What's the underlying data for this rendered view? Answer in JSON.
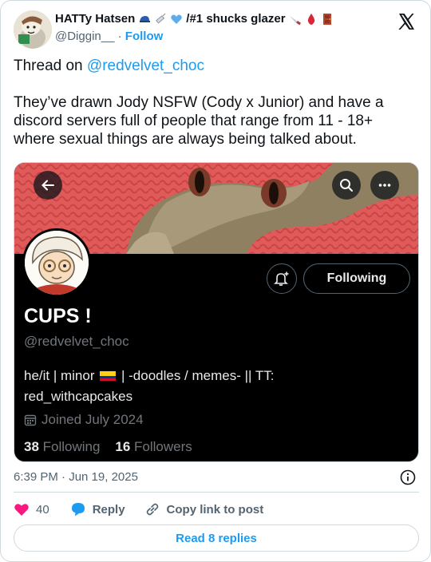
{
  "author": {
    "display_name": "HATTy Hatsen",
    "name_suffix": "/#1 shucks glazer",
    "handle": "@Diggin__",
    "separator": "·",
    "follow_label": "Follow"
  },
  "tweet": {
    "line1_prefix": "Thread on ",
    "line1_mention": "@redvelvet_choc",
    "body": "They’ve drawn Jody NSFW (Cody x Junior) and have a discord servers full of people that range from 11 - 18+ where sexual things are always being talked about."
  },
  "embedded_profile": {
    "name": "CUPS !",
    "handle": "@redvelvet_choc",
    "bio_part1": "he/it | minor",
    "bio_part2": "| -doodles / memes- || TT:",
    "bio_part3": "red_withcapcakes",
    "joined": "Joined July 2024",
    "following_count": "38",
    "following_label": "Following",
    "followers_count": "16",
    "followers_label": "Followers",
    "follow_button": "Following"
  },
  "meta": {
    "timestamp": "6:39 PM · Jun 19, 2025"
  },
  "actions": {
    "like_count": "40",
    "reply_label": "Reply",
    "copy_link_label": "Copy link to post",
    "read_replies_label": "Read 8 replies"
  },
  "colors": {
    "accent": "#1d9bf0",
    "like": "#f91880",
    "muted": "#536471"
  }
}
